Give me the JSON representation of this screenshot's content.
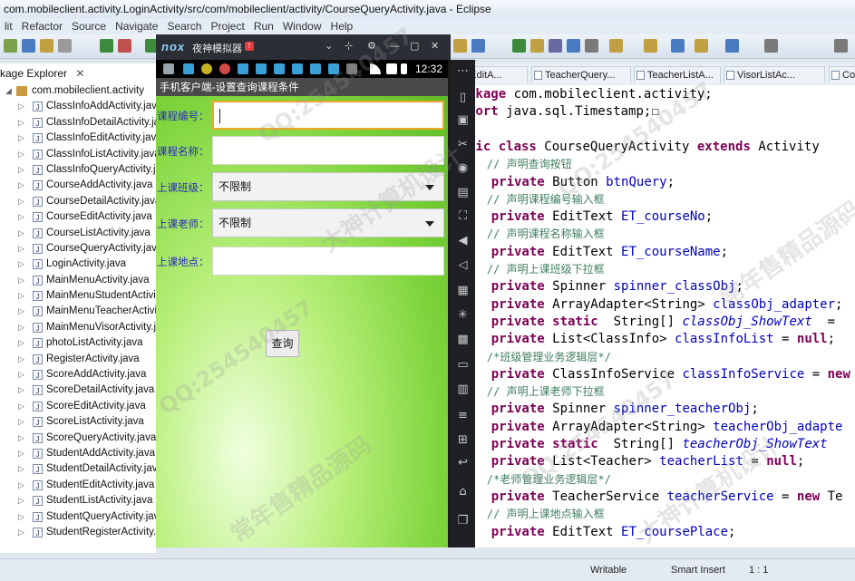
{
  "window": {
    "title": "com.mobileclient.activity.LoginActivity/src/com/mobileclient/activity/CourseQueryActivity.java - Eclipse"
  },
  "menu": [
    "lit",
    "Refactor",
    "Source",
    "Navigate",
    "Search",
    "Project",
    "Run",
    "Window",
    "Help"
  ],
  "package_explorer": {
    "tab_label": "kage Explorer",
    "root": "com.mobileclient.activity",
    "files": [
      "ClassInfoAddActivity.java",
      "ClassInfoDetailActivity.java",
      "ClassInfoEditActivity.java",
      "ClassInfoListActivity.java",
      "ClassInfoQueryActivity.java",
      "CourseAddActivity.java",
      "CourseDetailActivity.java",
      "CourseEditActivity.java",
      "CourseListActivity.java",
      "CourseQueryActivity.java",
      "LoginActivity.java",
      "MainMenuActivity.java",
      "MainMenuStudentActivity.java",
      "MainMenuTeacherActivity.java",
      "MainMenuVisorActivity.java",
      "photoListActivity.java",
      "RegisterActivity.java",
      "ScoreAddActivity.java",
      "ScoreDetailActivity.java",
      "ScoreEditActivity.java",
      "ScoreListActivity.java",
      "ScoreQueryActivity.java",
      "StudentAddActivity.java",
      "StudentDetailActivity.java",
      "StudentEditActivity.java",
      "StudentListActivity.java",
      "StudentQueryActivity.java",
      "StudentRegisterActivity.java"
    ]
  },
  "editor": {
    "tabs": [
      "etEditA...",
      "TeacherQuery...",
      "TeacherListA...",
      "VisorListAc...",
      "Co"
    ],
    "lines": [
      [
        {
          "t": "ckage ",
          "c": "kw"
        },
        {
          "t": "com.mobileclient.activity;",
          "c": ""
        }
      ],
      [
        {
          "t": "port ",
          "c": "kw"
        },
        {
          "t": "java.sql.Timestamp;",
          "c": ""
        },
        {
          "t": "☐",
          "c": ""
        }
      ],
      [
        {
          "t": "",
          "c": ""
        }
      ],
      [
        {
          "t": "lic ",
          "c": "kw"
        },
        {
          "t": "class ",
          "c": "kw"
        },
        {
          "t": "CourseQueryActivity ",
          "c": ""
        },
        {
          "t": "extends ",
          "c": "kw"
        },
        {
          "t": "Activity",
          "c": ""
        }
      ],
      [
        {
          "t": "    // 声明查询按钮",
          "c": "cm"
        }
      ],
      [
        {
          "t": "    ",
          "c": ""
        },
        {
          "t": "private ",
          "c": "kw"
        },
        {
          "t": "Button ",
          "c": ""
        },
        {
          "t": "btnQuery",
          "c": "fld"
        },
        {
          "t": ";",
          "c": ""
        }
      ],
      [
        {
          "t": "    // 声明课程编号输入框",
          "c": "cm"
        }
      ],
      [
        {
          "t": "    ",
          "c": ""
        },
        {
          "t": "private ",
          "c": "kw"
        },
        {
          "t": "EditText ",
          "c": ""
        },
        {
          "t": "ET_courseNo",
          "c": "fld"
        },
        {
          "t": ";",
          "c": ""
        }
      ],
      [
        {
          "t": "    // 声明课程名称输入框",
          "c": "cm"
        }
      ],
      [
        {
          "t": "    ",
          "c": ""
        },
        {
          "t": "private ",
          "c": "kw"
        },
        {
          "t": "EditText ",
          "c": ""
        },
        {
          "t": "ET_courseName",
          "c": "fld"
        },
        {
          "t": ";",
          "c": ""
        }
      ],
      [
        {
          "t": "    // 声明上课班级下拉框",
          "c": "cm"
        }
      ],
      [
        {
          "t": "    ",
          "c": ""
        },
        {
          "t": "private ",
          "c": "kw"
        },
        {
          "t": "Spinner ",
          "c": ""
        },
        {
          "t": "spinner_classObj",
          "c": "fld"
        },
        {
          "t": ";",
          "c": ""
        }
      ],
      [
        {
          "t": "    ",
          "c": ""
        },
        {
          "t": "private ",
          "c": "kw"
        },
        {
          "t": "ArrayAdapter<String> ",
          "c": ""
        },
        {
          "t": "classObj_adapter",
          "c": "fld"
        },
        {
          "t": ";",
          "c": ""
        }
      ],
      [
        {
          "t": "    ",
          "c": ""
        },
        {
          "t": "private static ",
          "c": "kw"
        },
        {
          "t": " String[] ",
          "c": ""
        },
        {
          "t": "classObj_ShowText",
          "c": "sfld"
        },
        {
          "t": "  =",
          "c": ""
        }
      ],
      [
        {
          "t": "    ",
          "c": ""
        },
        {
          "t": "private ",
          "c": "kw"
        },
        {
          "t": "List<ClassInfo> ",
          "c": ""
        },
        {
          "t": "classInfoList",
          "c": "fld"
        },
        {
          "t": " = ",
          "c": ""
        },
        {
          "t": "null",
          "c": "kw"
        },
        {
          "t": ";",
          "c": ""
        }
      ],
      [
        {
          "t": "    /*班级管理业务逻辑层*/",
          "c": "cm"
        }
      ],
      [
        {
          "t": "    ",
          "c": ""
        },
        {
          "t": "private ",
          "c": "kw"
        },
        {
          "t": "ClassInfoService ",
          "c": ""
        },
        {
          "t": "classInfoService",
          "c": "fld"
        },
        {
          "t": " = ",
          "c": ""
        },
        {
          "t": "new",
          "c": "kw"
        }
      ],
      [
        {
          "t": "    // 声明上课老师下拉框",
          "c": "cm"
        }
      ],
      [
        {
          "t": "    ",
          "c": ""
        },
        {
          "t": "private ",
          "c": "kw"
        },
        {
          "t": "Spinner ",
          "c": ""
        },
        {
          "t": "spinner_teacherObj",
          "c": "fld"
        },
        {
          "t": ";",
          "c": ""
        }
      ],
      [
        {
          "t": "    ",
          "c": ""
        },
        {
          "t": "private ",
          "c": "kw"
        },
        {
          "t": "ArrayAdapter<String> ",
          "c": ""
        },
        {
          "t": "teacherObj_adapte",
          "c": "fld"
        }
      ],
      [
        {
          "t": "    ",
          "c": ""
        },
        {
          "t": "private static ",
          "c": "kw"
        },
        {
          "t": " String[] ",
          "c": ""
        },
        {
          "t": "teacherObj_ShowText",
          "c": "sfld"
        }
      ],
      [
        {
          "t": "    ",
          "c": ""
        },
        {
          "t": "private ",
          "c": "kw"
        },
        {
          "t": "List<Teacher> ",
          "c": ""
        },
        {
          "t": "teacherList",
          "c": "fld"
        },
        {
          "t": " = ",
          "c": ""
        },
        {
          "t": "null",
          "c": "kw"
        },
        {
          "t": ";",
          "c": ""
        }
      ],
      [
        {
          "t": "    /*老师管理业务逻辑层*/",
          "c": "cm"
        }
      ],
      [
        {
          "t": "    ",
          "c": ""
        },
        {
          "t": "private ",
          "c": "kw"
        },
        {
          "t": "TeacherService ",
          "c": ""
        },
        {
          "t": "teacherService",
          "c": "fld"
        },
        {
          "t": " = ",
          "c": ""
        },
        {
          "t": "new ",
          "c": "kw"
        },
        {
          "t": "Te",
          "c": ""
        }
      ],
      [
        {
          "t": "    // 声明上课地点输入框",
          "c": "cm"
        }
      ],
      [
        {
          "t": "    ",
          "c": ""
        },
        {
          "t": "private ",
          "c": "kw"
        },
        {
          "t": "EditText ",
          "c": ""
        },
        {
          "t": "ET_coursePlace",
          "c": "fld"
        },
        {
          "t": ";",
          "c": ""
        }
      ]
    ]
  },
  "status": {
    "writable": "Writable",
    "insert_mode": "Smart Insert",
    "position": "1 : 1"
  },
  "emulator": {
    "logo": "nox",
    "name": "夜神模拟器",
    "badge": "!",
    "clock": "12:32",
    "app": {
      "title": "手机客户端-设置查询课程条件",
      "course_no_label": "课程编号：",
      "course_no_value": "",
      "course_name_label": "课程名称：",
      "course_name_value": "",
      "class_label": "上课班级：",
      "class_selected": "不限制",
      "teacher_label": "上课老师：",
      "teacher_selected": "不限制",
      "place_label": "上课地点：",
      "place_value": "",
      "query_button": "查询"
    }
  },
  "watermark": {
    "qq": "QQ:254540457",
    "shop": "大神计算机设计",
    "code": "常年售精品源码"
  },
  "colors": {
    "keyword": "#7f0055",
    "field": "#0000c0",
    "comment": "#3f7f5f",
    "label_blue": "#2b2bbd",
    "focus_orange": "#f0a628"
  }
}
